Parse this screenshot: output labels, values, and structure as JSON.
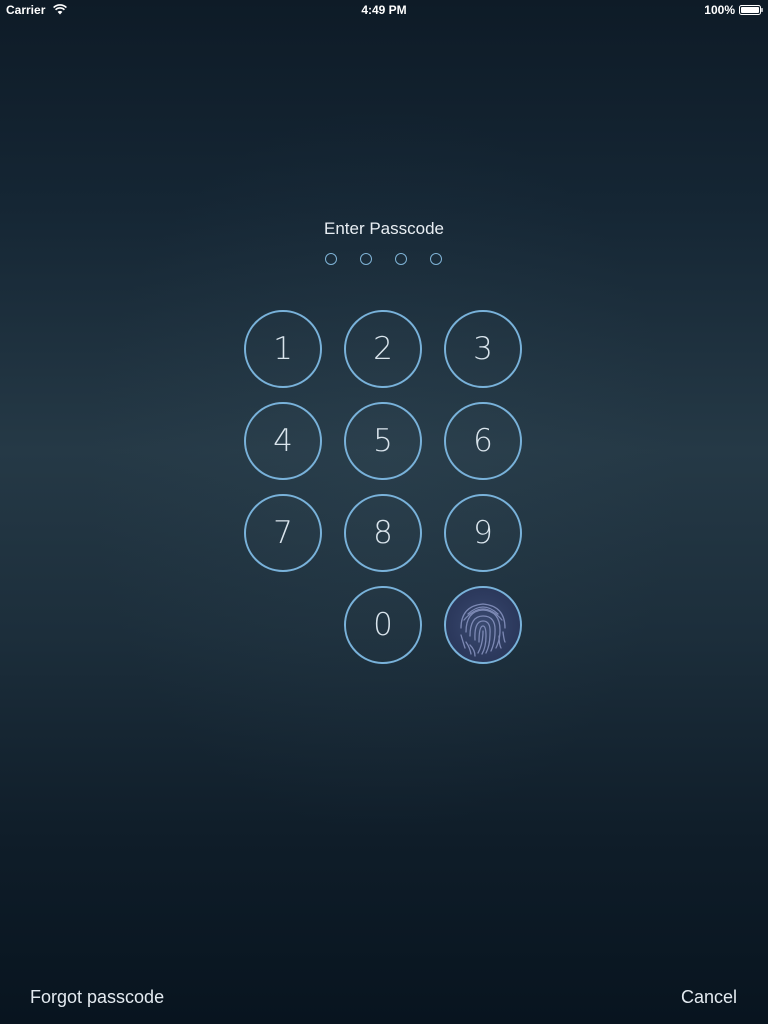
{
  "status_bar": {
    "carrier": "Carrier",
    "time": "4:49 PM",
    "battery": "100%"
  },
  "title": "Enter Passcode",
  "passcode_length": 4,
  "keypad": {
    "keys": [
      "1",
      "2",
      "3",
      "4",
      "5",
      "6",
      "7",
      "8",
      "9",
      "0"
    ],
    "touch_id_icon": "fingerprint-icon"
  },
  "actions": {
    "forgot": "Forgot passcode",
    "cancel": "Cancel"
  },
  "colors": {
    "accent": "#79b2da",
    "background_top": "#0e1b27",
    "background_mid": "#253946",
    "background_bottom": "#08141f",
    "fingerprint": "#2d3a5e"
  }
}
